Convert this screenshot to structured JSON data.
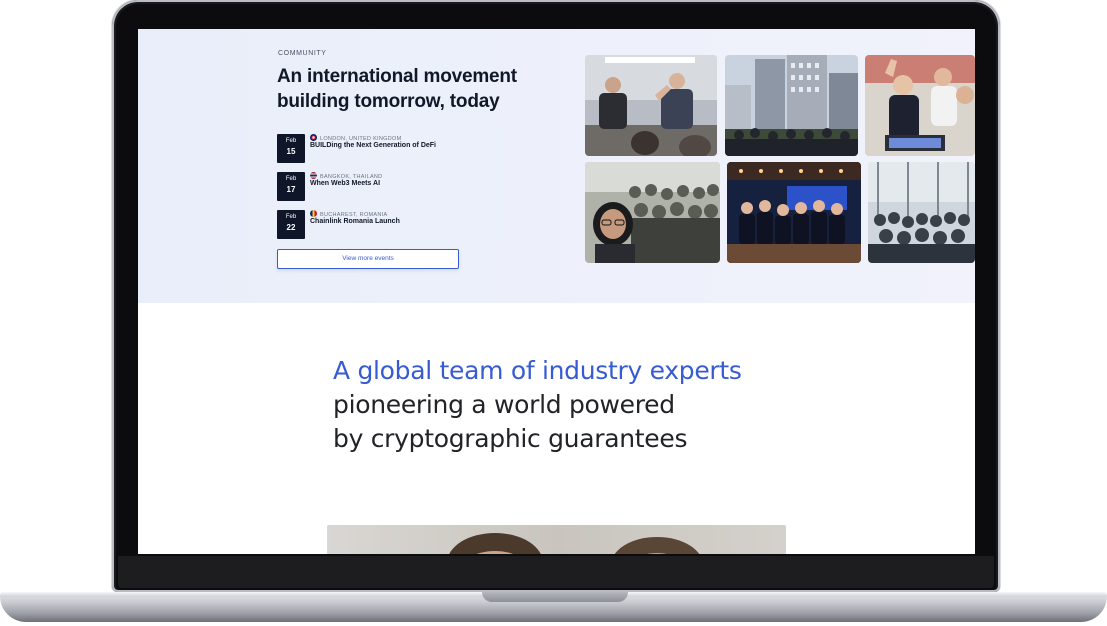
{
  "community": {
    "eyebrow": "COMMUNITY",
    "headline": "An international movement building tomorrow, today",
    "events": [
      {
        "month": "Feb",
        "day": "15",
        "location": "LONDON, UNITED KINGDOM",
        "title": "BUILDing the Next Generation of DeFi",
        "flag_color": "#c8102e"
      },
      {
        "month": "Feb",
        "day": "17",
        "location": "BANGKOK, THAILAND",
        "title": "When Web3 Meets AI",
        "flag_color": "#2d2a4a"
      },
      {
        "month": "Feb",
        "day": "22",
        "location": "BUCHAREST, ROMANIA",
        "title": "Chainlink Romania Launch",
        "flag_color": "#fcd116"
      }
    ],
    "view_more_label": "View more events"
  },
  "team": {
    "accent_line": "A global team of industry experts",
    "line_2": "pioneering a world powered",
    "line_3": "by cryptographic guarantees"
  },
  "colors": {
    "accent": "#375bd2",
    "date_box": "#0f1629"
  }
}
